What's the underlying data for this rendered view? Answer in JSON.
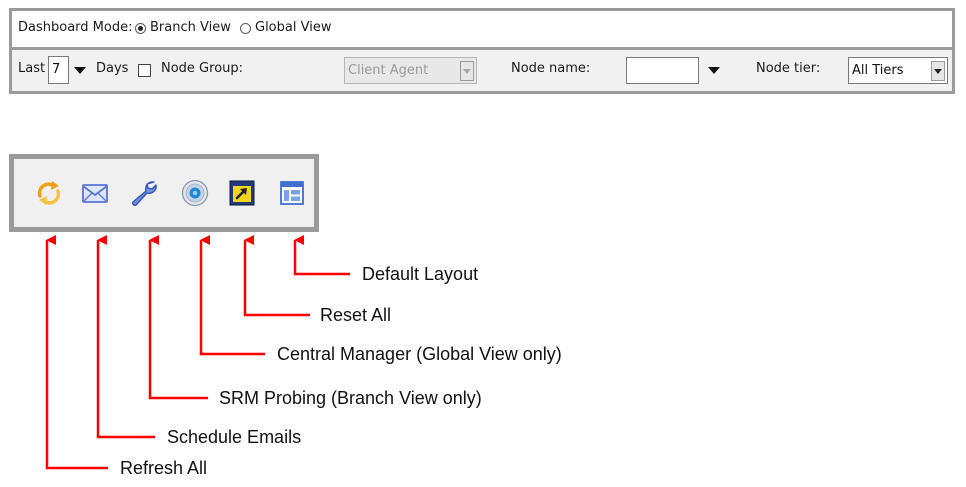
{
  "dashboard": {
    "mode_label": "Dashboard Mode:",
    "mode_options": [
      {
        "label": "Branch View",
        "selected": true
      },
      {
        "label": "Global View",
        "selected": false
      }
    ]
  },
  "filters": {
    "last_label": "Last",
    "days_value": "7",
    "days_label": "Days",
    "node_group_label": "Node Group:",
    "node_group_checked": false,
    "node_group_value": "Client Agent",
    "node_name_label": "Node name:",
    "node_name_value": "",
    "node_tier_label": "Node tier:",
    "node_tier_value": "All Tiers"
  },
  "toolbar": {
    "buttons": [
      {
        "name": "refresh-all",
        "icon": "refresh-icon",
        "label": "Refresh All"
      },
      {
        "name": "schedule-emails",
        "icon": "envelope-icon",
        "label": "Schedule Emails"
      },
      {
        "name": "srm-probing",
        "icon": "wrench-icon",
        "label": "SRM Probing (Branch View only)"
      },
      {
        "name": "central-manager",
        "icon": "globe-icon",
        "label": "Central Manager (Global View only)"
      },
      {
        "name": "reset-all",
        "icon": "reset-icon",
        "label": "Reset All"
      },
      {
        "name": "default-layout",
        "icon": "layout-icon",
        "label": "Default Layout"
      }
    ]
  },
  "colors": {
    "callout": "#ff0000",
    "panel_border": "#9a9a9a"
  }
}
